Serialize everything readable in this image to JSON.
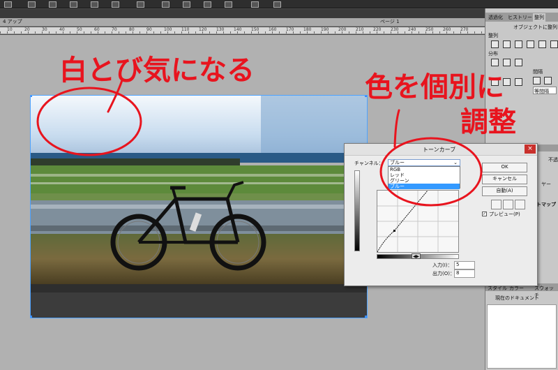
{
  "document": {
    "tab_label": "4 アップ",
    "page_label": "ページ 1",
    "ruler_numbers": [
      "10",
      "20",
      "30",
      "40",
      "50",
      "60",
      "70",
      "80",
      "90",
      "100",
      "110",
      "120",
      "130",
      "140",
      "150",
      "160",
      "170",
      "180",
      "190",
      "200",
      "210",
      "220",
      "230",
      "240",
      "250",
      "260",
      "270"
    ]
  },
  "right_panel": {
    "tabs": [
      "透過化",
      "ヒストリー",
      "整列"
    ],
    "title": "オブジェクトに整列",
    "section_align": "整列",
    "section_distribute": "分布",
    "distribute_spacing": "間隔",
    "spacing_label": "等間隔",
    "spacing_field": "0",
    "panel_label_1": "不透",
    "panel_label_2": "ヤー",
    "panel_label_3": "ットマップ",
    "bottom_tabs": [
      "スタイル",
      "カラー",
      "スウォッチ"
    ],
    "current_doc": "現在のドキュメント"
  },
  "dialog": {
    "title": "トーンカーブ",
    "close_label": "×",
    "channel_label": "チャンネル：",
    "channel_value": "ブルー",
    "channel_options": [
      "RGB",
      "レッド",
      "グリーン",
      "ブルー"
    ],
    "selected_option": "ブルー",
    "buttons": {
      "ok": "OK",
      "cancel": "キャンセル",
      "auto": "自動(A)"
    },
    "preview_label": "プレビュー(P)",
    "input_label": "入力(I)：",
    "input_value": "5",
    "output_label": "出力(O)：",
    "output_value": "8"
  },
  "annotations": {
    "left_note": "白とび気になる",
    "right_note_1": "色を個別に",
    "right_note_2": "調整"
  }
}
